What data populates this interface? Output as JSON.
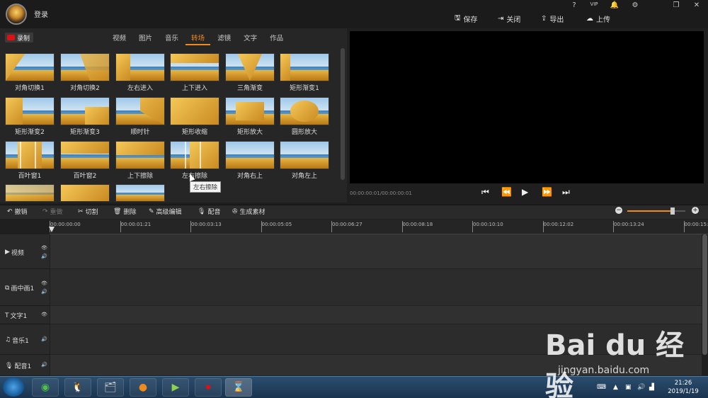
{
  "app": {
    "login": "登录"
  },
  "window_controls": [
    "?",
    "VIP",
    "🔔",
    "⚙",
    "❐",
    "✕"
  ],
  "toolbar": {
    "save": "保存",
    "close": "关闭",
    "export": "导出",
    "upload": "上传"
  },
  "record_label": "录制",
  "tabs": [
    {
      "label": "视频"
    },
    {
      "label": "图片"
    },
    {
      "label": "音乐"
    },
    {
      "label": "转场",
      "active": true
    },
    {
      "label": "滤镜"
    },
    {
      "label": "文字"
    },
    {
      "label": "作品"
    }
  ],
  "transitions": [
    {
      "label": "对角切换1"
    },
    {
      "label": "对角切换2"
    },
    {
      "label": "左右进入"
    },
    {
      "label": "上下进入"
    },
    {
      "label": "三角渐变"
    },
    {
      "label": "矩形渐变1"
    },
    {
      "label": "矩形渐变2"
    },
    {
      "label": "矩形渐变3"
    },
    {
      "label": "顺时针"
    },
    {
      "label": "矩形收缩"
    },
    {
      "label": "矩形放大"
    },
    {
      "label": "圆形放大"
    },
    {
      "label": "百叶窗1"
    },
    {
      "label": "百叶窗2"
    },
    {
      "label": "上下擦除"
    },
    {
      "label": "左右擦除"
    },
    {
      "label": "对角右上"
    },
    {
      "label": "对角左上"
    },
    {
      "label": ""
    },
    {
      "label": ""
    },
    {
      "label": ""
    }
  ],
  "tooltip": "左右擦除",
  "preview": {
    "timecode": "00:00:00:01/00:00:00:01"
  },
  "edit": {
    "undo": "撤销",
    "redo": "重做",
    "cut": "切割",
    "delete": "删除",
    "advanced": "高级编辑",
    "dub": "配音",
    "generate": "生成素材"
  },
  "ruler": [
    "00:00:00:00",
    "00:00:01:21",
    "00:00:03:13",
    "00:00:05:05",
    "00:00:06:27",
    "00:00:08:18",
    "00:00:10:10",
    "00:00:12:02",
    "00:00:13:24",
    "00:00:15:"
  ],
  "tracks": [
    {
      "label": "视频"
    },
    {
      "label": "画中画1"
    },
    {
      "label": "文字1"
    },
    {
      "label": "音乐1"
    },
    {
      "label": "配音1"
    }
  ],
  "clock": {
    "time": "21:26",
    "date": "2019/1/19"
  },
  "watermark": {
    "brand": "Bai du 经验",
    "url": "jingyan.baidu.com"
  }
}
